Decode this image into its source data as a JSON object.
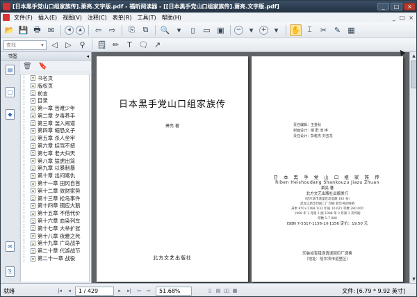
{
  "window": {
    "title": "[日本黑手党山口组家族传].萧亮.文字版.pdf - 福昕阅读器 - [[日本黑手党山口组家族传].萧亮.文字版.pdf]",
    "controls": [
      "_",
      "□",
      "×"
    ]
  },
  "menu": {
    "items": [
      "文件(F)",
      "插入(E)",
      "视图(V)",
      "注释(C)",
      "表单(R)",
      "工具(T)",
      "帮助(H)"
    ],
    "right_controls": [
      "_",
      "□",
      "×"
    ]
  },
  "toolbar": {
    "search_placeholder": "查找"
  },
  "sidebar": {
    "title": "书签",
    "collapse": "◂",
    "bookmarks": [
      "书名页",
      "版权页",
      "前言",
      "目录",
      "第一章 苦难少年",
      "第二章 夕毒养手",
      "第三章 湍入闹道",
      "第四章 缩恐文子",
      "第五章 杀人坐牢",
      "第六章 娃驾不扭",
      "第七章 老大归天",
      "第八章 猛虎出笼",
      "第九章 以暴制暴",
      "第十章 出闷喀仇",
      "第十一章 田冈自首",
      "第十二章 敛财家势",
      "第十三章 松岛事件",
      "第十四章 钢应大鹅",
      "第十五章 不借代价",
      "第十六章 血染列车",
      "第十七章 大举扩张",
      "第十八章 夜雅之死",
      "第十九章 广岛战争",
      "第二十章 代游战节",
      "第二十一章 战役"
    ]
  },
  "page1": {
    "title": "日本黑手党山口组家族传",
    "author": "萧亮 著",
    "publisher": "北方文艺出版社"
  },
  "page2": {
    "credits": [
      "责任编辑：王金秋",
      "封面设计：楼 群 浩 棒",
      "责任设计：彭乾杰 刘玉龙"
    ],
    "cip_title": "日 本 黑 手 党 山 口 组 家 族 传",
    "cip_pinyin": "Riben Heishoudang Shankouzu Jiazu Zhuan",
    "cip_author": "萧亮 著",
    "cip_lines": [
      "北方文艺出版社出版发行",
      "（哈尔滨市道里区友谊路 182 号）",
      "黑龙江新华印刷二厂印刷 新华书店经销",
      "开本 850×1168 1/32 印张 10.625 字数 280 000",
      "1998 年 3 月第 1 版 1998 年 3 月第 1 次印刷",
      "印数 1-7 000"
    ],
    "isbn": "ISBN 7-5317-1156-1/I·1156 定价：19.50 元",
    "printer_note": "印装如有错误请退回印厂调换",
    "printer_addr": "（地址：哈尔滨市道里区）"
  },
  "status": {
    "ready": "就绪",
    "page": "1 / 429",
    "zoom": "51.68%",
    "docsize": "文件: [6.79 * 9.92 英寸]"
  }
}
